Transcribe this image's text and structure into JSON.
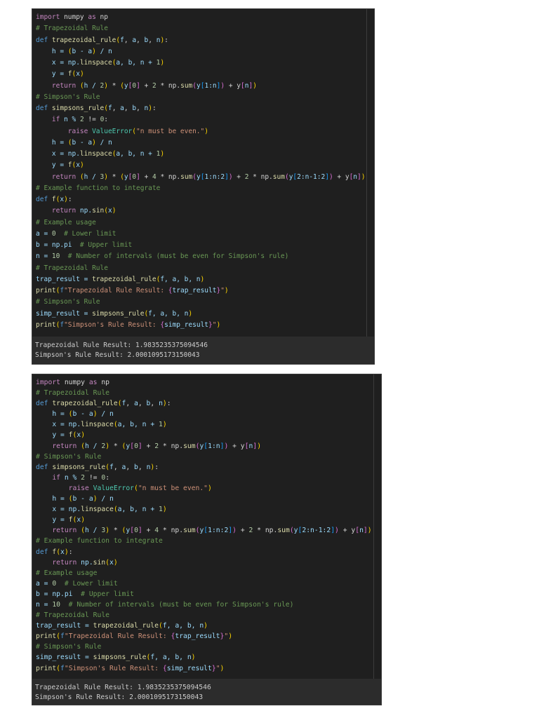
{
  "colors": {
    "background": "#1f1f1f",
    "output_background": "#2c2c2c"
  },
  "code_lines": [
    [
      [
        "import",
        "c"
      ],
      [
        " numpy ",
        "t"
      ],
      [
        "as",
        "c"
      ],
      [
        " np",
        "t"
      ]
    ],
    [
      [
        "# Trapezoidal Rule",
        "m"
      ]
    ],
    [
      [
        "def ",
        "k"
      ],
      [
        "trapezoidal_rule",
        "f"
      ],
      [
        "(",
        "b1"
      ],
      [
        "f",
        "v"
      ],
      [
        ", ",
        "t"
      ],
      [
        "a",
        "v"
      ],
      [
        ", ",
        "t"
      ],
      [
        "b",
        "v"
      ],
      [
        ", ",
        "t"
      ],
      [
        "n",
        "v"
      ],
      [
        ")",
        "b1"
      ],
      [
        ":",
        "t"
      ]
    ],
    [
      [
        "    h = ",
        "v"
      ],
      [
        "(",
        "b1"
      ],
      [
        "b - a",
        "v"
      ],
      [
        ")",
        "b1"
      ],
      [
        " / n",
        "v"
      ]
    ],
    [
      [
        "    x = np.",
        "v"
      ],
      [
        "linspace",
        "f"
      ],
      [
        "(",
        "b1"
      ],
      [
        "a, b, n + ",
        "v"
      ],
      [
        "1",
        "n"
      ],
      [
        ")",
        "b1"
      ]
    ],
    [
      [
        "    y = ",
        "v"
      ],
      [
        "f",
        "f"
      ],
      [
        "(",
        "b1"
      ],
      [
        "x",
        "v"
      ],
      [
        ")",
        "b1"
      ]
    ],
    [
      [
        "    return ",
        "c"
      ],
      [
        "(",
        "b1"
      ],
      [
        "h / ",
        "v"
      ],
      [
        "2",
        "n"
      ],
      [
        ")",
        "b1"
      ],
      [
        " * ",
        "t"
      ],
      [
        "(",
        "b1"
      ],
      [
        "y",
        "v"
      ],
      [
        "[",
        "b2"
      ],
      [
        "0",
        "n"
      ],
      [
        "]",
        "b2"
      ],
      [
        " + ",
        "t"
      ],
      [
        "2",
        "n"
      ],
      [
        " * np.",
        "t"
      ],
      [
        "sum",
        "f"
      ],
      [
        "(",
        "b2"
      ],
      [
        "y",
        "v"
      ],
      [
        "[",
        "b3"
      ],
      [
        "1:n",
        "v"
      ],
      [
        "]",
        "b3"
      ],
      [
        ")",
        "b2"
      ],
      [
        " + y",
        "t"
      ],
      [
        "[",
        "b2"
      ],
      [
        "n",
        "v"
      ],
      [
        "]",
        "b2"
      ],
      [
        ")",
        "b1"
      ]
    ],
    [
      [
        "# Simpson's Rule",
        "m"
      ]
    ],
    [
      [
        "def ",
        "k"
      ],
      [
        "simpsons_rule",
        "f"
      ],
      [
        "(",
        "b1"
      ],
      [
        "f",
        "v"
      ],
      [
        ", ",
        "t"
      ],
      [
        "a",
        "v"
      ],
      [
        ", ",
        "t"
      ],
      [
        "b",
        "v"
      ],
      [
        ", ",
        "t"
      ],
      [
        "n",
        "v"
      ],
      [
        ")",
        "b1"
      ],
      [
        ":",
        "t"
      ]
    ],
    [
      [
        "    if ",
        "c"
      ],
      [
        "n % ",
        "v"
      ],
      [
        "2",
        "n"
      ],
      [
        " != ",
        "t"
      ],
      [
        "0",
        "n"
      ],
      [
        ":",
        "t"
      ]
    ],
    [
      [
        "        raise ",
        "c"
      ],
      [
        "ValueError",
        "cl"
      ],
      [
        "(",
        "b1"
      ],
      [
        "\"n must be even.\"",
        "s"
      ],
      [
        ")",
        "b1"
      ]
    ],
    [
      [
        "    h = ",
        "v"
      ],
      [
        "(",
        "b1"
      ],
      [
        "b - a",
        "v"
      ],
      [
        ")",
        "b1"
      ],
      [
        " / n",
        "v"
      ]
    ],
    [
      [
        "    x = np.",
        "v"
      ],
      [
        "linspace",
        "f"
      ],
      [
        "(",
        "b1"
      ],
      [
        "a, b, n + ",
        "v"
      ],
      [
        "1",
        "n"
      ],
      [
        ")",
        "b1"
      ]
    ],
    [
      [
        "    y = ",
        "v"
      ],
      [
        "f",
        "f"
      ],
      [
        "(",
        "b1"
      ],
      [
        "x",
        "v"
      ],
      [
        ")",
        "b1"
      ]
    ],
    [
      [
        "    return ",
        "c"
      ],
      [
        "(",
        "b1"
      ],
      [
        "h / ",
        "v"
      ],
      [
        "3",
        "n"
      ],
      [
        ")",
        "b1"
      ],
      [
        " * ",
        "t"
      ],
      [
        "(",
        "b1"
      ],
      [
        "y",
        "v"
      ],
      [
        "[",
        "b2"
      ],
      [
        "0",
        "n"
      ],
      [
        "]",
        "b2"
      ],
      [
        " + ",
        "t"
      ],
      [
        "4",
        "n"
      ],
      [
        " * np.",
        "t"
      ],
      [
        "sum",
        "f"
      ],
      [
        "(",
        "b2"
      ],
      [
        "y",
        "v"
      ],
      [
        "[",
        "b3"
      ],
      [
        "1:n:2",
        "v"
      ],
      [
        "]",
        "b3"
      ],
      [
        ")",
        "b2"
      ],
      [
        " + ",
        "t"
      ],
      [
        "2",
        "n"
      ],
      [
        " * np.",
        "t"
      ],
      [
        "sum",
        "f"
      ],
      [
        "(",
        "b2"
      ],
      [
        "y",
        "v"
      ],
      [
        "[",
        "b3"
      ],
      [
        "2:n-1:2",
        "v"
      ],
      [
        "]",
        "b3"
      ],
      [
        ")",
        "b2"
      ],
      [
        " + y",
        "t"
      ],
      [
        "[",
        "b2"
      ],
      [
        "n",
        "v"
      ],
      [
        "]",
        "b2"
      ],
      [
        ")",
        "b1"
      ]
    ],
    [
      [
        "# Example function to integrate",
        "m"
      ]
    ],
    [
      [
        "def ",
        "k"
      ],
      [
        "f",
        "f"
      ],
      [
        "(",
        "b1"
      ],
      [
        "x",
        "v"
      ],
      [
        ")",
        "b1"
      ],
      [
        ":",
        "t"
      ]
    ],
    [
      [
        "    return ",
        "c"
      ],
      [
        "np.",
        "v"
      ],
      [
        "sin",
        "f"
      ],
      [
        "(",
        "b1"
      ],
      [
        "x",
        "v"
      ],
      [
        ")",
        "b1"
      ]
    ],
    [
      [
        "# Example usage",
        "m"
      ]
    ],
    [
      [
        "a = ",
        "v"
      ],
      [
        "0",
        "n"
      ],
      [
        "  # Lower limit",
        "m"
      ]
    ],
    [
      [
        "b = np.pi",
        "v"
      ],
      [
        "  # Upper limit",
        "m"
      ]
    ],
    [
      [
        "n = ",
        "v"
      ],
      [
        "10",
        "n"
      ],
      [
        "  # Number of intervals (must be even for Simpson's rule)",
        "m"
      ]
    ],
    [
      [
        "# Trapezoidal Rule",
        "m"
      ]
    ],
    [
      [
        "trap_result = ",
        "v"
      ],
      [
        "trapezoidal_rule",
        "f"
      ],
      [
        "(",
        "b1"
      ],
      [
        "f, a, b, n",
        "v"
      ],
      [
        ")",
        "b1"
      ]
    ],
    [
      [
        "print",
        "f"
      ],
      [
        "(",
        "b1"
      ],
      [
        "f",
        "k"
      ],
      [
        "\"Trapezoidal Rule Result: ",
        "s"
      ],
      [
        "{",
        "b2"
      ],
      [
        "trap_result",
        "v"
      ],
      [
        "}",
        "b2"
      ],
      [
        "\"",
        "s"
      ],
      [
        ")",
        "b1"
      ]
    ],
    [
      [
        "# Simpson's Rule",
        "m"
      ]
    ],
    [
      [
        "simp_result = ",
        "v"
      ],
      [
        "simpsons_rule",
        "f"
      ],
      [
        "(",
        "b1"
      ],
      [
        "f, a, b, n",
        "v"
      ],
      [
        ")",
        "b1"
      ]
    ],
    [
      [
        "print",
        "f"
      ],
      [
        "(",
        "b1"
      ],
      [
        "f",
        "k"
      ],
      [
        "\"Simpson's Rule Result: ",
        "s"
      ],
      [
        "{",
        "b2"
      ],
      [
        "simp_result",
        "v"
      ],
      [
        "}",
        "b2"
      ],
      [
        "\"",
        "s"
      ],
      [
        ")",
        "b1"
      ]
    ]
  ],
  "output": {
    "line1": "Trapezoidal Rule Result: 1.9835235375094546",
    "line2": "Simpson's Rule Result: 2.0001095173150043"
  }
}
